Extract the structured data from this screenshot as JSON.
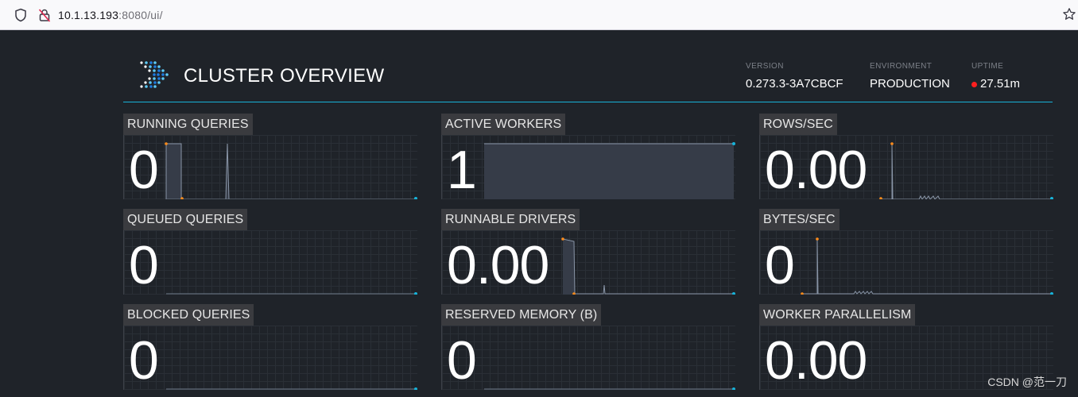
{
  "browser": {
    "url_host": "10.1.13.193",
    "url_rest": ":8080/ui/"
  },
  "header": {
    "title": "CLUSTER OVERVIEW",
    "version_label": "VERSION",
    "version_value": "0.273.3-3A7CBCF",
    "environment_label": "ENVIRONMENT",
    "environment_value": "PRODUCTION",
    "uptime_label": "UPTIME",
    "uptime_value": "27.51m",
    "uptime_status_color": "#ff1f1f",
    "accent_color": "#17b3d9"
  },
  "tiles": [
    {
      "label": "RUNNING QUERIES",
      "value": "0"
    },
    {
      "label": "ACTIVE WORKERS",
      "value": "1"
    },
    {
      "label": "ROWS/SEC",
      "value": "0.00"
    },
    {
      "label": "QUEUED QUERIES",
      "value": "0"
    },
    {
      "label": "RUNNABLE DRIVERS",
      "value": "0.00"
    },
    {
      "label": "BYTES/SEC",
      "value": "0"
    },
    {
      "label": "BLOCKED QUERIES",
      "value": "0"
    },
    {
      "label": "RESERVED MEMORY (B)",
      "value": "0"
    },
    {
      "label": "WORKER PARALLELISM",
      "value": "0.00"
    }
  ],
  "watermark": "CSDN @范一刀"
}
